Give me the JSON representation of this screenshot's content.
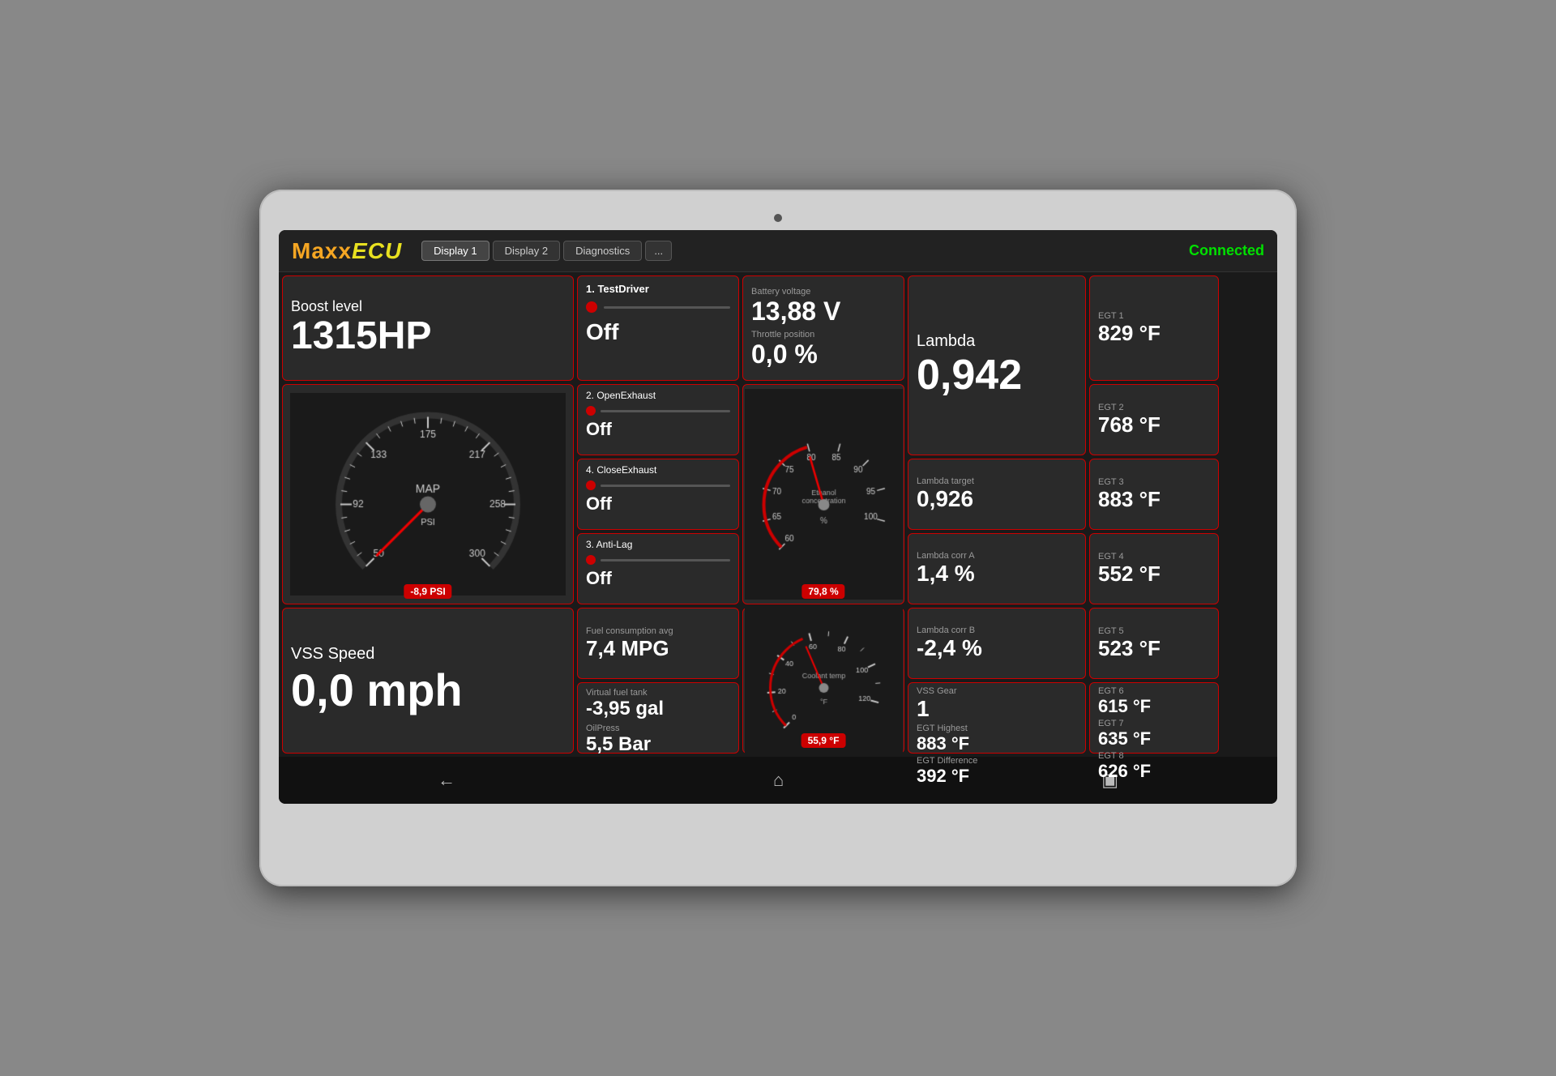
{
  "app": {
    "logo_maxx": "Maxx",
    "logo_ecu": "ECU",
    "status": "Connected"
  },
  "tabs": [
    {
      "label": "Display 1",
      "active": true
    },
    {
      "label": "Display 2",
      "active": false
    },
    {
      "label": "Diagnostics",
      "active": false
    },
    {
      "label": "...",
      "active": false
    }
  ],
  "boost": {
    "label": "Boost level",
    "value": "1315HP",
    "psi": "-8,9 PSI"
  },
  "map_gauge": {
    "label": "MAP",
    "unit": "PSI",
    "min": 50,
    "max": 300,
    "value": -8.9
  },
  "vss": {
    "label": "VSS Speed",
    "value": "0,0 mph"
  },
  "driver": {
    "label": "1. TestDriver",
    "state": "Off"
  },
  "switches": [
    {
      "label": "2. OpenExhaust",
      "state": "Off"
    },
    {
      "label": "4. CloseExhaust",
      "state": "Off"
    },
    {
      "label": "3. Anti-Lag",
      "state": "Off"
    }
  ],
  "fuel_consumption": {
    "label": "Fuel consumption avg",
    "value": "7,4 MPG"
  },
  "virtual_fuel": {
    "label": "Virtual fuel tank",
    "value": "-3,95 gal"
  },
  "oil_press": {
    "label": "OilPress",
    "value": "5,5 Bar"
  },
  "battery": {
    "label": "Battery voltage",
    "value": "13,88 V"
  },
  "throttle": {
    "label": "Throttle position",
    "value": "0,0 %"
  },
  "ethanol_gauge": {
    "label": "Ethanol concentration",
    "unit": "%",
    "value": "79,8 %",
    "min": 60,
    "max": 100,
    "needle": 79.8
  },
  "coolant_gauge": {
    "label": "Coolant temp",
    "unit": "°F",
    "value": "55,9 °F",
    "min": 0,
    "max": 120,
    "needle": 55.9
  },
  "lambda": {
    "label": "Lambda",
    "value": "0,942"
  },
  "lambda_target": {
    "label": "Lambda target",
    "value": "0,926"
  },
  "lambda_corr_a": {
    "label": "Lambda corr A",
    "value": "1,4 %"
  },
  "lambda_corr_b": {
    "label": "Lambda corr B",
    "value": "-2,4 %"
  },
  "vss_gear": {
    "label": "VSS Gear",
    "value": "1"
  },
  "egt_highest": {
    "label": "EGT Highest",
    "value": "883 °F"
  },
  "egt_difference": {
    "label": "EGT Difference",
    "value": "392 °F"
  },
  "egts": [
    {
      "label": "EGT 1",
      "value": "829 °F"
    },
    {
      "label": "EGT 2",
      "value": "768 °F"
    },
    {
      "label": "EGT 3",
      "value": "883 °F"
    },
    {
      "label": "EGT 4",
      "value": "552 °F"
    },
    {
      "label": "EGT 5",
      "value": "523 °F"
    },
    {
      "label": "EGT 6",
      "value": "615 °F"
    },
    {
      "label": "EGT 7",
      "value": "635 °F"
    },
    {
      "label": "EGT 8",
      "value": "626 °F"
    }
  ],
  "nav": {
    "back": "←",
    "home": "⌂",
    "recent": "▣"
  }
}
